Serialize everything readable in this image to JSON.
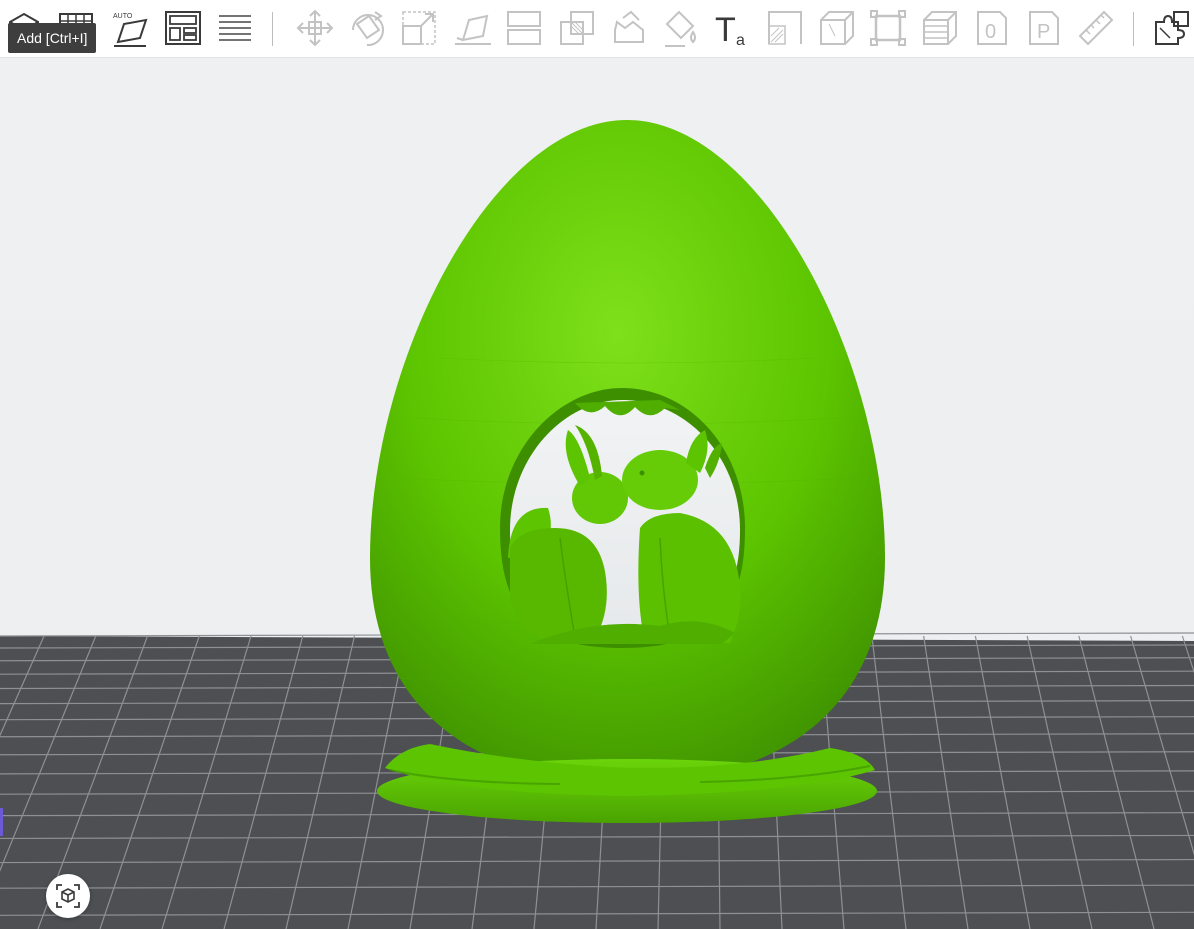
{
  "toolbar": {
    "tooltip": "Add [Ctrl+I]",
    "auto_label": "AUTO",
    "text_tool_glyph": "T",
    "text_tool_sub": "a",
    "counter_glyph": "0",
    "plate_glyph": "P",
    "icons": [
      {
        "name": "add-icon",
        "state": "active"
      },
      {
        "name": "grid-icon",
        "state": "active"
      },
      {
        "name": "auto-orient-icon",
        "state": "active"
      },
      {
        "name": "arrange-icon",
        "state": "active"
      },
      {
        "name": "layers-icon",
        "state": "active"
      },
      {
        "name": "move-icon",
        "state": "disabled"
      },
      {
        "name": "rotate-icon",
        "state": "disabled"
      },
      {
        "name": "scale-icon",
        "state": "disabled"
      },
      {
        "name": "lay-on-face-icon",
        "state": "disabled"
      },
      {
        "name": "cut-icon",
        "state": "disabled"
      },
      {
        "name": "boolean-icon",
        "state": "disabled"
      },
      {
        "name": "support-paint-icon",
        "state": "disabled"
      },
      {
        "name": "color-paint-icon",
        "state": "disabled"
      },
      {
        "name": "text-tool-icon",
        "state": "active"
      },
      {
        "name": "seam-icon",
        "state": "disabled"
      },
      {
        "name": "box-icon",
        "state": "disabled"
      },
      {
        "name": "fit-frame-icon",
        "state": "disabled"
      },
      {
        "name": "slice-stack-icon",
        "state": "disabled"
      },
      {
        "name": "counter-icon",
        "state": "disabled"
      },
      {
        "name": "plate-icon",
        "state": "disabled"
      },
      {
        "name": "measure-icon",
        "state": "disabled"
      },
      {
        "name": "assembly-icon",
        "state": "active"
      }
    ]
  },
  "scene": {
    "model_color": "#5cc400",
    "model_highlight": "#7ee01a",
    "model_shadow": "#3d8f00",
    "bed_color": "#4d4f52",
    "bed_grid_color": "#8e9094",
    "background_color": "#eef0f2"
  }
}
